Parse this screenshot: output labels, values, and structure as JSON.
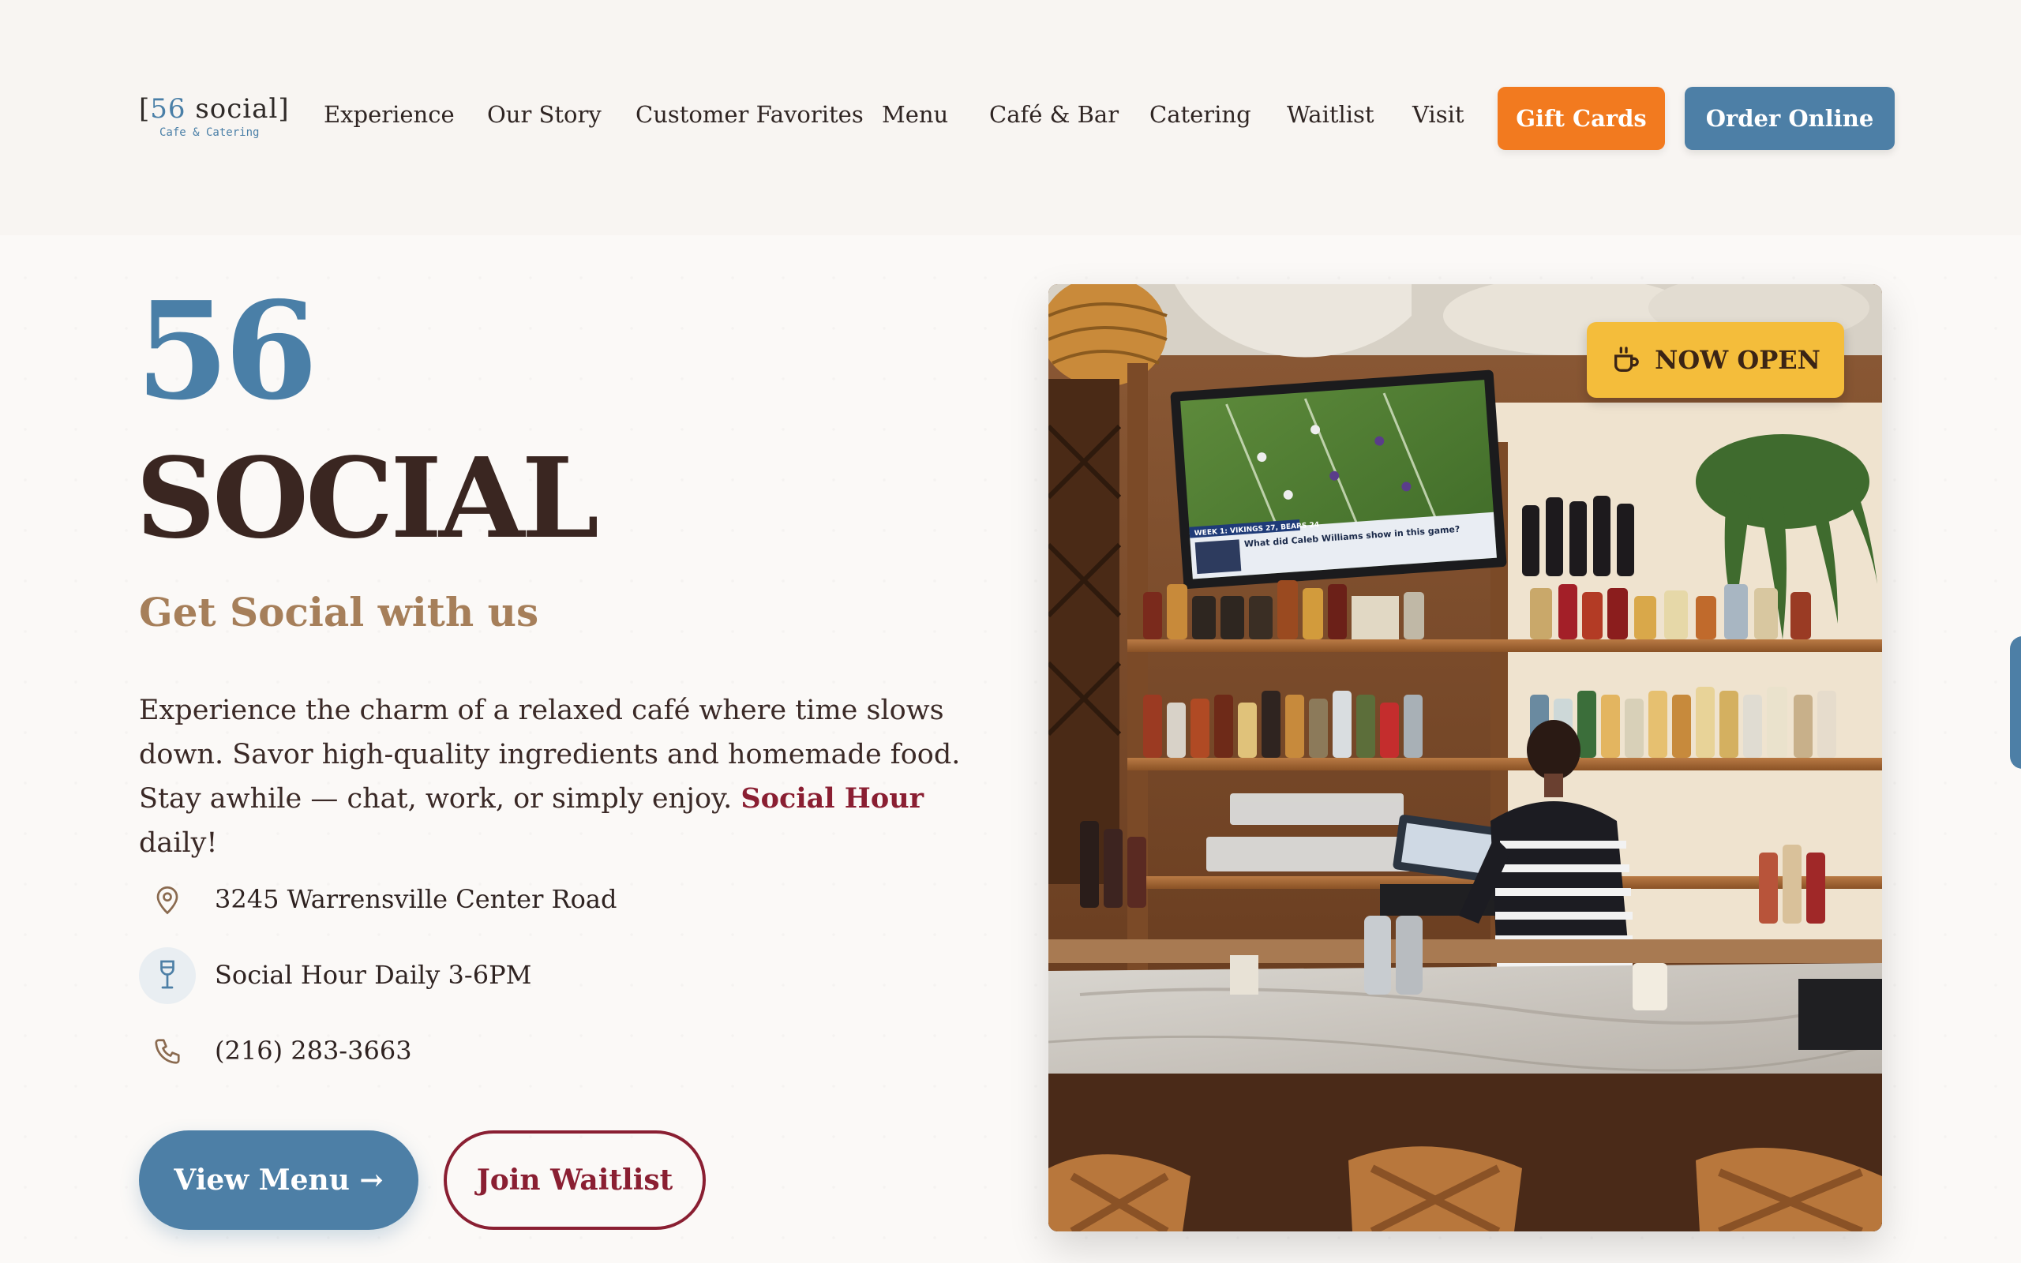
{
  "brand": {
    "logo_prefix": "[",
    "logo_number": "56",
    "logo_word": " social]",
    "logo_sub": "Cafe & Catering"
  },
  "nav": {
    "items": [
      "Experience",
      "Our Story",
      "Customer Favorites",
      "Menu",
      "Café & Bar",
      "Catering",
      "Waitlist",
      "Visit"
    ],
    "gift_cards": "Gift Cards",
    "order_online": "Order Online"
  },
  "hero": {
    "number": "56",
    "word": "SOCIAL",
    "tagline": "Get Social with us",
    "description_part1": "Experience the charm of a relaxed café where time slows down. Savor high-quality ingredients and homemade food. Stay awhile — chat, work, or simply enjoy. ",
    "description_highlight": "Social Hour",
    "description_part2": " daily!",
    "info": [
      {
        "icon": "location-pin-icon",
        "text": "3245 Warrensville Center Road"
      },
      {
        "icon": "wine-glass-icon",
        "text": "Social Hour Daily 3-6PM"
      },
      {
        "icon": "phone-icon",
        "text": "(216) 283-3663"
      }
    ],
    "view_menu": "View Menu →",
    "join_waitlist": "Join Waitlist"
  },
  "photo": {
    "badge": "NOW OPEN",
    "tv_headline": "What did Caleb Williams show in this game?",
    "tv_ticker": "WEEK 1: VIKINGS 27, BEARS 24"
  },
  "colors": {
    "accent_blue": "#4d7fa6",
    "accent_orange": "#f27a1f",
    "accent_maroon": "#8a1f32",
    "accent_tan": "#a67f5a",
    "badge_yellow": "#f4bd3b"
  }
}
